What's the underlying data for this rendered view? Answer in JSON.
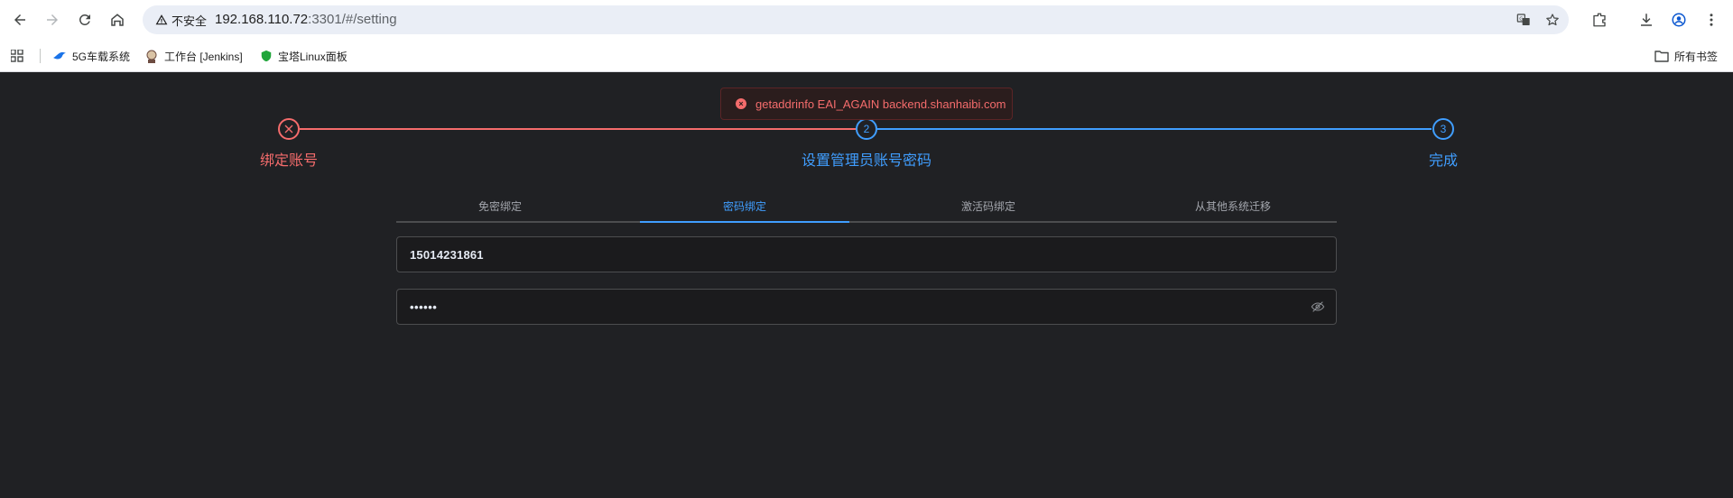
{
  "browser": {
    "security_label": "不安全",
    "url_host": "192.168.110.72",
    "url_rest": ":3301/#/setting",
    "bookmarks": [
      {
        "label": "5G车载系统",
        "icon": "bird-icon"
      },
      {
        "label": "工作台 [Jenkins]",
        "icon": "jenkins-icon"
      },
      {
        "label": "宝塔Linux面板",
        "icon": "shield-icon"
      }
    ],
    "all_bookmarks_label": "所有书签"
  },
  "toast": {
    "message": "getaddrinfo EAI_AGAIN backend.shanhaibi.com",
    "color": "#f56c6c"
  },
  "steps": [
    {
      "index": "1",
      "title": "绑定账号",
      "status": "error",
      "icon": "close-icon"
    },
    {
      "index": "2",
      "title": "设置管理员账号密码",
      "status": "process"
    },
    {
      "index": "3",
      "title": "完成",
      "status": "process"
    }
  ],
  "tabs": [
    {
      "label": "免密绑定",
      "active": false
    },
    {
      "label": "密码绑定",
      "active": true
    },
    {
      "label": "激活码绑定",
      "active": false
    },
    {
      "label": "从其他系统迁移",
      "active": false
    }
  ],
  "form": {
    "account_value": "15014231861",
    "password_mask": "••••••"
  },
  "colors": {
    "accent": "#409eff",
    "error": "#f56c6c",
    "background": "#202124"
  }
}
